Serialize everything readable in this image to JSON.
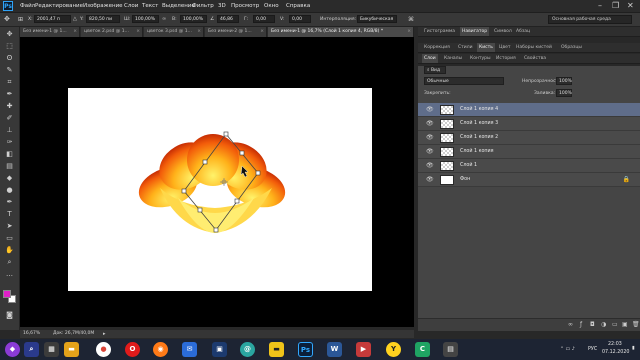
{
  "app": {
    "logo": "Ps"
  },
  "menu": [
    "Файл",
    "Редактирование",
    "Изображение",
    "Слои",
    "Текст",
    "Выделение",
    "Фильтр",
    "3D",
    "Просмотр",
    "Окно",
    "Справка"
  ],
  "window_buttons": [
    "–",
    "❐",
    "✕"
  ],
  "options": {
    "x_label": "X:",
    "x_value": "2001,47 п",
    "y_label": "Y:",
    "y_value": "820,50 пи",
    "w_label": "Ш:",
    "w_value": "100,00%",
    "h_label": "В:",
    "h_value": "100,00%",
    "angle_value": "46,86",
    "hskew_label": "Г:",
    "hskew_value": "0,00",
    "vskew_label": "V:",
    "vskew_value": "0,00",
    "interp_label": "Интерполяция:",
    "interp_value": "Бикубическая"
  },
  "workspace": {
    "select": "Основная рабочая среда"
  },
  "doc_tabs": [
    {
      "label": "Без имени-1 @ 1..."
    },
    {
      "label": "цветок 2.psd @ 1..."
    },
    {
      "label": "цветок 3.psd @ 1..."
    },
    {
      "label": "Без имени-2 @ 1..."
    },
    {
      "label": "Без имени-1 @ 16,7% (Слой 1 копия 4, RGB/8) *"
    }
  ],
  "panel_tabs_row1": [
    "Гистограмма",
    "Навигатор",
    "Символ",
    "Абзац"
  ],
  "panel_tabs_row2": [
    "Коррекция",
    "Стили",
    "Кисть",
    "Цвет",
    "Наборы кистей",
    "Образцы"
  ],
  "panel_tabs_row3": [
    "Слои",
    "Каналы",
    "Контуры",
    "История",
    "Свойства"
  ],
  "layers_panel": {
    "filter_label": "Вид",
    "blend_mode": "Обычные",
    "opacity_label": "Непрозрачность:",
    "opacity_value": "100%",
    "lock_label": "Закрепить:",
    "fill_label": "Заливка:",
    "fill_value": "100%",
    "layers": [
      {
        "name": "Слой 1 копия 4",
        "selected": true
      },
      {
        "name": "Слой 1 копия 3",
        "selected": false
      },
      {
        "name": "Слой 1 копия 2",
        "selected": false
      },
      {
        "name": "Слой 1 копия",
        "selected": false
      },
      {
        "name": "Слой 1",
        "selected": false
      },
      {
        "name": "Фон",
        "selected": false
      }
    ]
  },
  "status": {
    "zoom": "16,67%",
    "doc_info": "Док: 26,7M/40,0M"
  },
  "taskbar": {
    "time": "22:03",
    "date": "07.12.2020",
    "lang": "РУС"
  },
  "colors": {
    "foreground": "#e020c8",
    "background": "#ffffff",
    "selection": "#5f6d8a"
  }
}
